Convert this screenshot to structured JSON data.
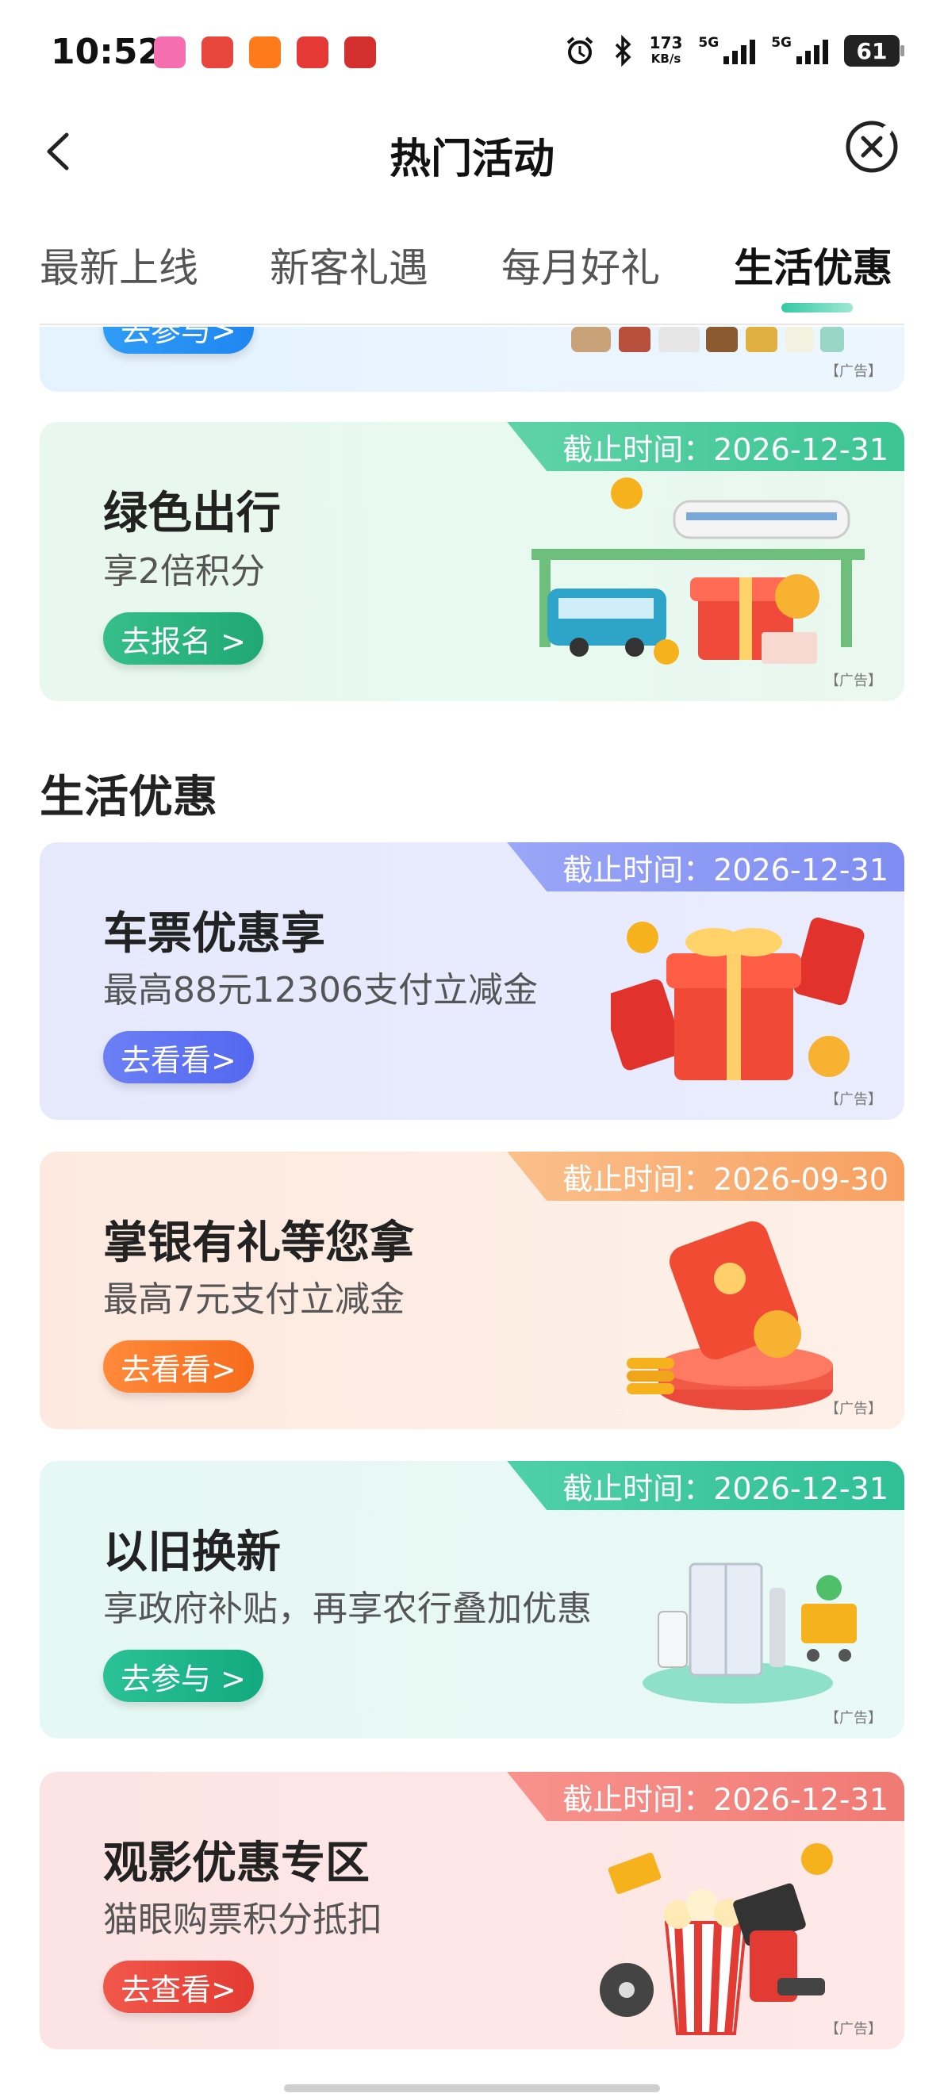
{
  "status_bar": {
    "time": "10:52",
    "speed_value": "173",
    "speed_unit": "KB/s",
    "net1": "5G",
    "net2": "5G",
    "battery": "61"
  },
  "nav": {
    "title": "热门活动"
  },
  "tabs": [
    {
      "label": "最新上线"
    },
    {
      "label": "新客礼遇"
    },
    {
      "label": "每月好礼"
    },
    {
      "label": "生活优惠"
    }
  ],
  "partial_card": {
    "button": "去参与>",
    "ad": "【广告】"
  },
  "green_card": {
    "deadline": "截止时间：2026-12-31",
    "title": "绿色出行",
    "subtitle": "享2倍积分",
    "button": "去报名 >",
    "ad": "【广告】"
  },
  "section_title": "生活优惠",
  "cards": [
    {
      "deadline": "截止时间：2026-12-31",
      "title": "车票优惠享",
      "subtitle": "最高88元12306支付立减金",
      "button": "去看看>",
      "ad": "【广告】",
      "accent": "#7a8cf0"
    },
    {
      "deadline": "截止时间：2026-09-30",
      "title": "掌银有礼等您拿",
      "subtitle": "最高7元支付立减金",
      "button": "去看看>",
      "ad": "【广告】",
      "accent": "#f7a264"
    },
    {
      "deadline": "截止时间：2026-12-31",
      "title": "以旧换新",
      "subtitle": "享政府补贴，再享农行叠加优惠",
      "button": "去参与 >",
      "ad": "【广告】",
      "accent": "#2fbf97"
    },
    {
      "deadline": "截止时间：2026-12-31",
      "title": "观影优惠专区",
      "subtitle": "猫眼购票积分抵扣",
      "button": "去查看>",
      "ad": "【广告】",
      "accent": "#f07a74"
    }
  ]
}
